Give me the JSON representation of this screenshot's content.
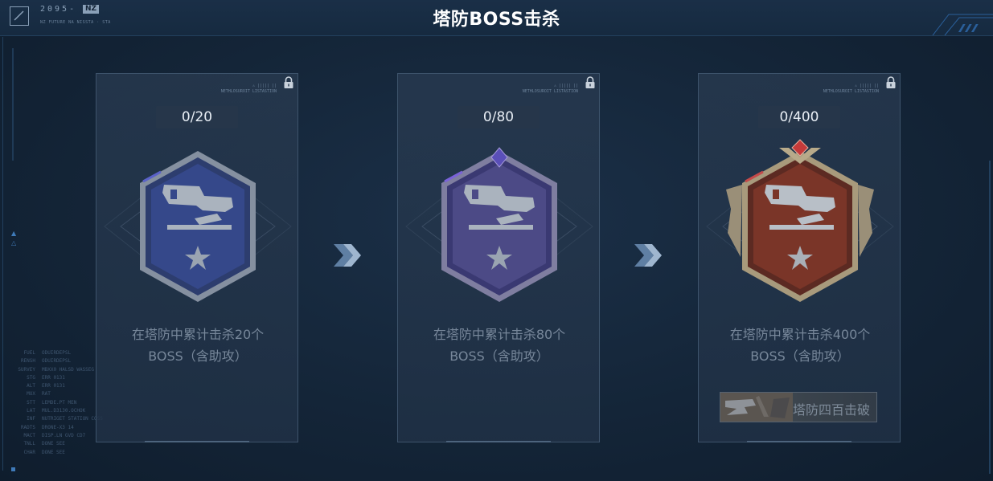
{
  "header": {
    "title": "塔防BOSS击杀",
    "logo_year": "2095-",
    "logo_tag": "NZ",
    "logo_sub": "NZ FUTURE NA NISSTA · STA"
  },
  "hud": {
    "rows": [
      {
        "k": "FUEL",
        "v": "ODUIRDEPSL"
      },
      {
        "k": "RENSH",
        "v": "ODUIRDEPSL"
      },
      {
        "k": "SURVEY",
        "v": "MBXX0 HALSD WASSEG"
      },
      {
        "k": "STG",
        "v": "ERR 0131"
      },
      {
        "k": "ALT",
        "v": "ERR 0131"
      },
      {
        "k": "MUX",
        "v": "RAT"
      },
      {
        "k": "STT",
        "v": "LEMDE.PT MEN"
      },
      {
        "k": "LAT",
        "v": "MUL.D3130.OCHOK"
      },
      {
        "k": "INF",
        "v": "NUTRIGET STATION COSS"
      },
      {
        "k": "RADTS",
        "v": "DRONE-X3 14"
      },
      {
        "k": "MACT",
        "v": "DISP.LN GVD CD7"
      },
      {
        "k": "TNLL",
        "v": "DONE SEE"
      },
      {
        "k": "CHAR",
        "v": "DONE SEE"
      }
    ]
  },
  "cards": [
    {
      "progress": "0/20",
      "desc_line1": "在塔防中累计击杀20个",
      "desc_line2": "BOSS（含助攻）",
      "tier": "blue",
      "locked": true,
      "reward": null
    },
    {
      "progress": "0/80",
      "desc_line1": "在塔防中累计击杀80个",
      "desc_line2": "BOSS（含助攻）",
      "tier": "purple",
      "locked": true,
      "reward": null
    },
    {
      "progress": "0/400",
      "desc_line1": "在塔防中累计击杀400个",
      "desc_line2": "BOSS（含助攻）",
      "tier": "red",
      "locked": true,
      "reward": {
        "label": "塔防四百击破"
      }
    }
  ],
  "icons": {
    "lock": "lock-icon",
    "arrow": "double-chevron-right-icon",
    "badge_emblem": "gun-turret-emblem-icon",
    "star": "star-icon"
  },
  "colors": {
    "tier_blue": "#3a4f8c",
    "tier_purple": "#4c4a86",
    "tier_red": "#7a3528",
    "frame_silver": "#9aa6b4",
    "frame_gold": "#a89a7c"
  }
}
